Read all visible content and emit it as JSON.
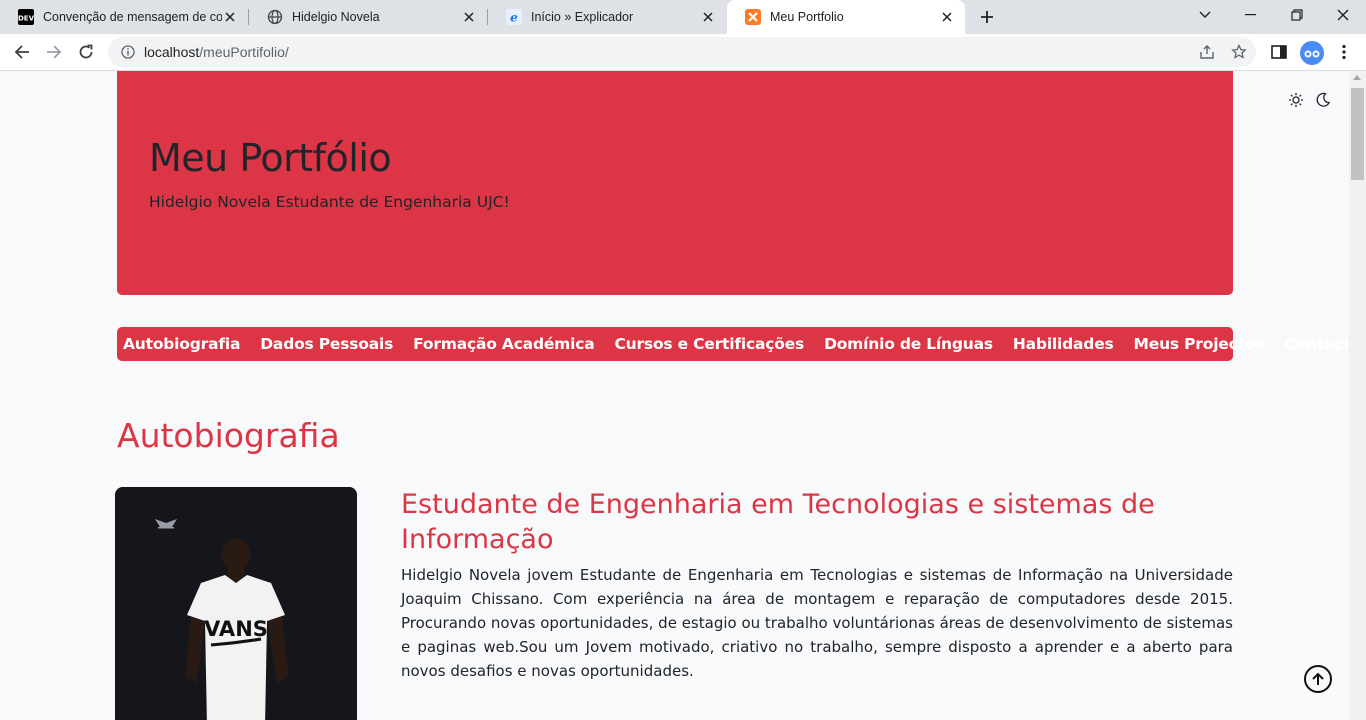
{
  "browser": {
    "tabs": [
      {
        "title": "Convenção de mensagem de commit",
        "favicon": "dev-icon",
        "active": false
      },
      {
        "title": "Hidelgio Novela",
        "favicon": "globe-icon",
        "active": false
      },
      {
        "title": "Início » Explicador",
        "favicon": "e-icon",
        "active": false
      },
      {
        "title": "Meu Portfolio",
        "favicon": "xampp-icon",
        "active": true
      }
    ],
    "url_host": "localhost",
    "url_path": "/meuPortifolio/"
  },
  "hero": {
    "title": "Meu Portfólio",
    "subtitle": "Hidelgio Novela Estudante de Engenharia UJC!"
  },
  "nav": {
    "items": [
      "Autobiografia",
      "Dados Pessoais",
      "Formação Académica",
      "Cursos e Certificações",
      "Domínio de Línguas",
      "Habilidades",
      "Meus Projectos",
      "Contactos"
    ]
  },
  "autobiografia": {
    "section_title": "Autobiografia",
    "heading": "Estudante de Engenharia em Tecnologias e sistemas de Informação",
    "text": "Hidelgio Novela jovem Estudante de Engenharia em Tecnologias e sistemas de Informação na Universidade Joaquim Chissano. Com experiência na área de montagem e reparação de computadores desde 2015. Procurando novas oportunidades, de estagio ou trabalho voluntárionas áreas de desenvolvimento de sistemas e paginas web.Sou um Jovem motivado, criativo no trabalho, sempre disposto a aprender e a aberto para novos desafios e novas oportunidades.",
    "shirt_text": "VANS"
  },
  "colors": {
    "accent": "#dc3545",
    "text": "#212529",
    "page_bg": "#f8f9fa"
  }
}
